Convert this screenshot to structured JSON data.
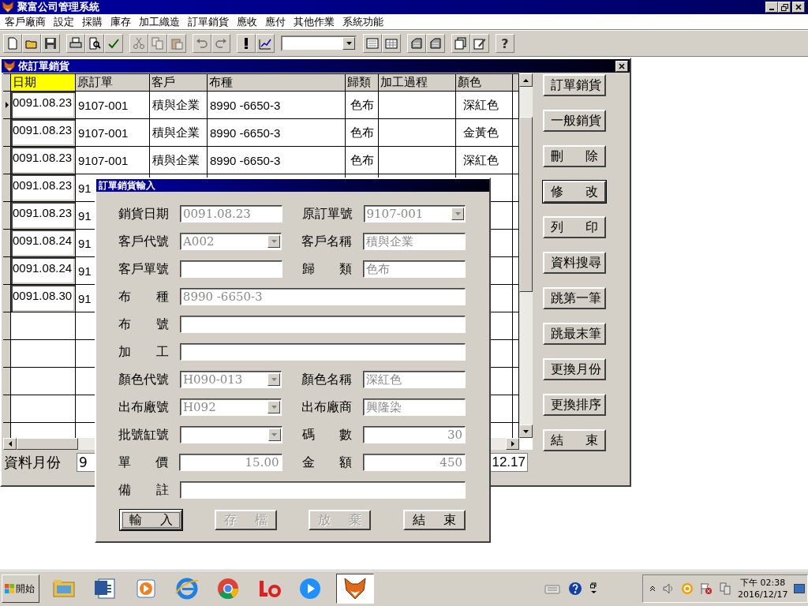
{
  "app": {
    "title": "聚富公司管理系統"
  },
  "menu": [
    "客戶廠商",
    "設定",
    "採購",
    "庫存",
    "加工織造",
    "訂單銷貨",
    "應收",
    "應付",
    "其他作業",
    "系統功能"
  ],
  "toolbar": {
    "groups": [
      [
        {
          "kind": "new",
          "disabled": false
        },
        {
          "kind": "open",
          "disabled": false
        },
        {
          "kind": "save",
          "disabled": false
        }
      ],
      [
        {
          "kind": "print",
          "disabled": false
        },
        {
          "kind": "preview",
          "disabled": false
        },
        {
          "kind": "spell",
          "disabled": false
        }
      ],
      [
        {
          "kind": "cut",
          "disabled": true
        },
        {
          "kind": "copy",
          "disabled": true
        },
        {
          "kind": "paste",
          "disabled": true
        }
      ],
      [
        {
          "kind": "undo",
          "disabled": true
        },
        {
          "kind": "redo",
          "disabled": true
        }
      ],
      [
        {
          "kind": "alert",
          "disabled": false
        },
        {
          "kind": "chart",
          "disabled": false
        }
      ],
      [
        {
          "kind": "combo"
        }
      ],
      [
        {
          "kind": "form",
          "disabled": false
        },
        {
          "kind": "grid",
          "disabled": false
        }
      ],
      [
        {
          "kind": "stack",
          "disabled": false
        },
        {
          "kind": "stack",
          "disabled": false
        }
      ],
      [
        {
          "kind": "pages",
          "disabled": false
        },
        {
          "kind": "edit",
          "disabled": false
        }
      ],
      [
        {
          "kind": "help",
          "label": "?"
        }
      ]
    ]
  },
  "child_window": {
    "title": "依訂單銷貨",
    "grid": {
      "columns": [
        {
          "label": "日期",
          "highlighted": true
        },
        {
          "label": "原訂單",
          "highlighted": false
        },
        {
          "label": "客戶",
          "highlighted": false
        },
        {
          "label": "布種",
          "highlighted": false
        },
        {
          "label": "歸類",
          "highlighted": false
        },
        {
          "label": "加工過程",
          "highlighted": false
        },
        {
          "label": "顏色",
          "highlighted": false
        }
      ],
      "rows": [
        {
          "selected": true,
          "cells": [
            "0091.08.23",
            "9107-001",
            "積與企業",
            "8990 -6650-3",
            "色布",
            null,
            "深紅色"
          ]
        },
        {
          "selected": false,
          "cells": [
            "0091.08.23",
            "9107-001",
            "積與企業",
            "8990 -6650-3",
            "色布",
            null,
            "金黃色"
          ]
        },
        {
          "selected": false,
          "cells": [
            "0091.08.23",
            "9107-001",
            "積與企業",
            "8990 -6650-3",
            "色布",
            null,
            "深紅色"
          ]
        },
        {
          "selected": false,
          "cells": [
            "0091.08.23",
            "91"
          ]
        },
        {
          "selected": false,
          "cells": [
            "0091.08.23",
            "91"
          ]
        },
        {
          "selected": false,
          "cells": [
            "0091.08.24",
            "91"
          ]
        },
        {
          "selected": false,
          "cells": [
            "0091.08.24",
            "91"
          ]
        },
        {
          "selected": false,
          "cells": [
            "0091.08.30",
            "91"
          ]
        }
      ]
    },
    "month": {
      "label": "資料月份",
      "value": "9",
      "field_2": "12.17"
    },
    "buttons": [
      {
        "label": "訂單銷貨",
        "focused": false
      },
      {
        "label": "一般銷貨",
        "focused": false
      },
      {
        "label": "刪 除",
        "focused": false
      },
      {
        "label": "修 改",
        "focused": true
      },
      {
        "label": "列 印",
        "focused": false
      },
      {
        "label": "資料搜尋",
        "focused": false
      },
      {
        "label": "跳第一筆",
        "focused": false
      },
      {
        "label": "跳最末筆",
        "focused": false
      },
      {
        "label": "更換月份",
        "focused": false
      },
      {
        "label": "更換排序",
        "focused": false
      },
      {
        "label": "結 束",
        "focused": false
      }
    ]
  },
  "dialog": {
    "title": "訂單銷貨輸入",
    "rows": [
      [
        {
          "label": "銷貨日期",
          "kind": "text",
          "value": "0091.08.23",
          "disabled": true
        },
        {
          "label": "原訂單號",
          "kind": "combo",
          "value": "9107-001",
          "disabled": true
        }
      ],
      [
        {
          "label": "客戶代號",
          "kind": "combo",
          "value": "A002",
          "disabled": true
        },
        {
          "label": "客戶名稱",
          "kind": "text",
          "value": "積與企業",
          "disabled": true
        }
      ],
      [
        {
          "label": "客戶單號",
          "kind": "text"
        },
        {
          "label": "歸 類",
          "kind": "text",
          "value": "色布",
          "disabled": true
        }
      ],
      [
        {
          "label": "布 種",
          "kind": "text",
          "value": "8990 -6650-3",
          "disabled": true
        }
      ],
      [
        {
          "label": "布 號",
          "kind": "text"
        }
      ],
      [
        {
          "label": "加 工",
          "kind": "text"
        }
      ],
      [
        {
          "label": "顏色代號",
          "kind": "combo",
          "value": "H090-013",
          "disabled": true
        },
        {
          "label": "顏色名稱",
          "kind": "text",
          "value": "深紅色",
          "disabled": true
        }
      ],
      [
        {
          "label": "出布廠號",
          "kind": "combo",
          "value": "H092",
          "disabled": true
        },
        {
          "label": "出布廠商",
          "kind": "text",
          "value": "興隆染",
          "disabled": true
        }
      ],
      [
        {
          "label": "批號缸號",
          "kind": "combo",
          "disabled": true
        },
        {
          "label": "碼 數",
          "kind": "number",
          "value": "30",
          "disabled": true
        }
      ],
      [
        {
          "label": "單 價",
          "kind": "number",
          "value": "15.00",
          "disabled": true
        },
        {
          "label": "金 額",
          "kind": "number",
          "value": "450",
          "disabled": true
        }
      ],
      [
        {
          "label": "備 註",
          "kind": "text"
        }
      ]
    ],
    "buttons": [
      {
        "label": "輸 入",
        "focused": true,
        "disabled": false
      },
      {
        "label": "存 檔",
        "focused": false,
        "disabled": true
      },
      {
        "label": "放 棄",
        "focused": false,
        "disabled": true
      },
      {
        "label": "結 束",
        "focused": false,
        "disabled": false
      }
    ]
  },
  "taskbar": {
    "start": "開始",
    "apps": [
      {
        "kind": "folder",
        "active": false
      },
      {
        "kind": "word",
        "active": false
      },
      {
        "kind": "media",
        "active": false
      },
      {
        "kind": "browser",
        "active": false
      },
      {
        "kind": "chrome",
        "active": false
      },
      {
        "kind": "le",
        "active": false
      },
      {
        "kind": "play",
        "active": false
      },
      {
        "kind": "fox",
        "active": true
      }
    ],
    "clock": {
      "time": "下午 02:38",
      "date": "2016/12/17"
    }
  }
}
